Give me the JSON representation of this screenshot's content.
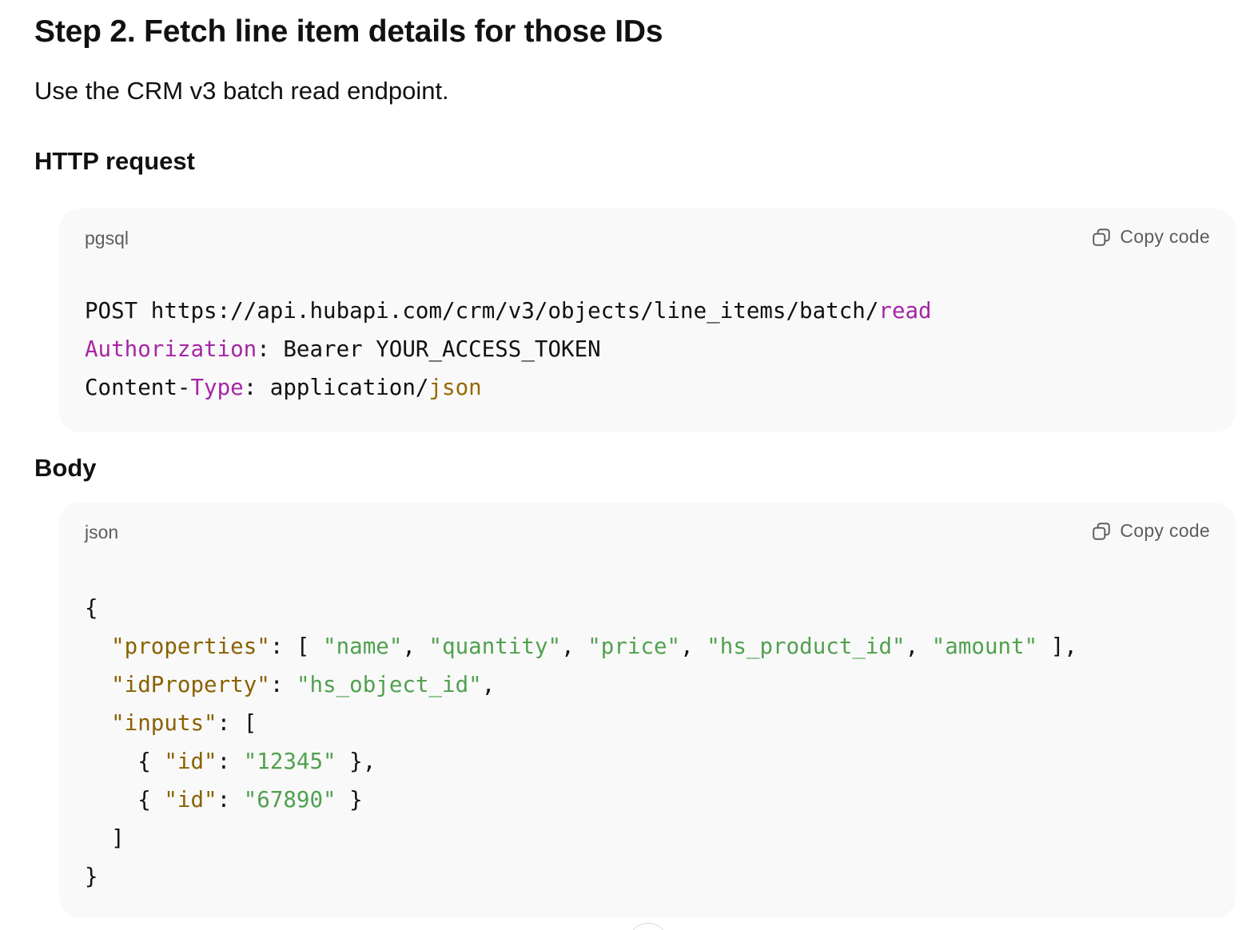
{
  "heading": "Step 2. Fetch line item details for those IDs",
  "intro": "Use the CRM v3 batch read endpoint.",
  "http_section": {
    "title": "HTTP request",
    "language": "pgsql",
    "copy_label": "Copy code",
    "copy_icon": "copy-icon",
    "lines": {
      "l1_method_url": "POST https://api.hubapi.com/crm/v3/objects/line_items/batch/",
      "l1_keyword": "read",
      "l2_header": "Authorization",
      "l2_value": ": Bearer YOUR_ACCESS_TOKEN",
      "l3_prefix": "Content-",
      "l3_type": "Type",
      "l3_value": ": application/",
      "l3_json": "json"
    }
  },
  "body_section": {
    "title": "Body",
    "language": "json",
    "copy_label": "Copy code",
    "copy_icon": "copy-icon",
    "json": {
      "open_brace": "{",
      "properties_key": "\"properties\"",
      "properties_values": [
        "\"name\"",
        "\"quantity\"",
        "\"price\"",
        "\"hs_product_id\"",
        "\"amount\""
      ],
      "idProperty_key": "\"idProperty\"",
      "idProperty_value": "\"hs_object_id\"",
      "inputs_key": "\"inputs\"",
      "id_key": "\"id\"",
      "input_ids": [
        "\"12345\"",
        "\"67890\""
      ],
      "close_bracket": "]",
      "close_brace": "}"
    }
  },
  "colors": {
    "keyword": "#a626a4",
    "type": "#986801",
    "json_key": "#8a6200",
    "string": "#50a14f",
    "code_bg": "#f9f9f9"
  }
}
